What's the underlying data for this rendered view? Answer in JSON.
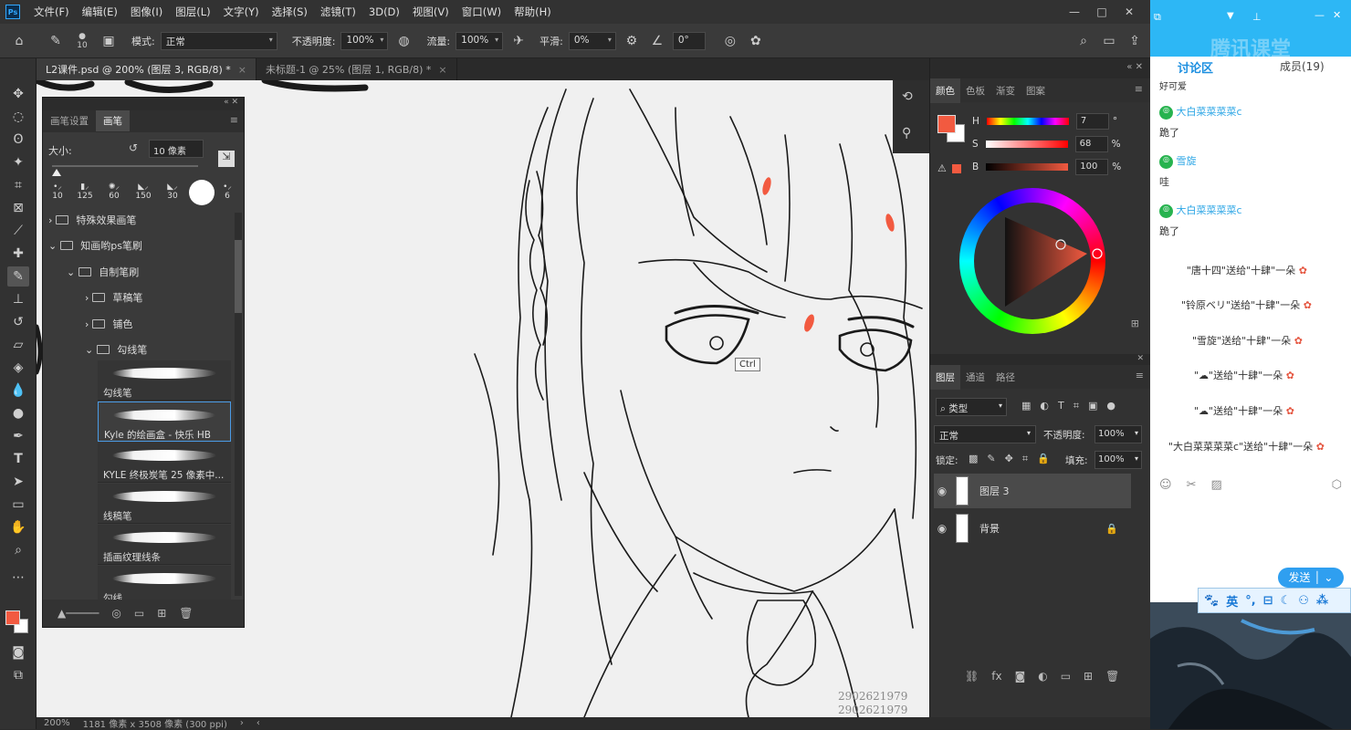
{
  "app": {
    "name": "Ps"
  },
  "menu": [
    "文件(F)",
    "编辑(E)",
    "图像(I)",
    "图层(L)",
    "文字(Y)",
    "选择(S)",
    "滤镜(T)",
    "3D(D)",
    "视图(V)",
    "窗口(W)",
    "帮助(H)"
  ],
  "window_controls": [
    "—",
    "□",
    "✕"
  ],
  "options": {
    "brush_size": "10",
    "mode_label": "模式:",
    "mode_value": "正常",
    "opacity_label": "不透明度:",
    "opacity_value": "100%",
    "flow_label": "流量:",
    "flow_value": "100%",
    "smooth_label": "平滑:",
    "smooth_value": "0%",
    "angle_value": "0°"
  },
  "tabs": [
    {
      "label": "L2课件.psd @ 200% (图层 3, RGB/8) *",
      "active": true
    },
    {
      "label": "未标题-1 @ 25% (图层 1, RGB/8) *",
      "active": false
    }
  ],
  "brush_panel": {
    "tab_settings": "画笔设置",
    "tab_brush": "画笔",
    "size_label": "大小:",
    "size_value": "10 像素",
    "presets": [
      "10",
      "125",
      "60",
      "150",
      "30",
      "6"
    ],
    "folders": [
      {
        "label": "特殊效果画笔",
        "expanded": false
      },
      {
        "label": "知画哟ps笔刷",
        "expanded": true
      },
      {
        "label": "自制笔刷",
        "expanded": true
      },
      {
        "label": "草稿笔",
        "expanded": false
      },
      {
        "label": "铺色",
        "expanded": false
      },
      {
        "label": "勾线笔",
        "expanded": true
      }
    ],
    "brushes": [
      {
        "label": "勾线笔",
        "selected": false
      },
      {
        "label": "Kyle 的绘画盒 - 快乐 HB",
        "selected": true
      },
      {
        "label": "KYLE 终极炭笔 25 像素中...",
        "selected": false
      },
      {
        "label": "线稿笔",
        "selected": false
      },
      {
        "label": "插画纹理线条",
        "selected": false
      },
      {
        "label": "勾线",
        "selected": false
      }
    ]
  },
  "color_panel": {
    "tabs": [
      "颜色",
      "色板",
      "渐变",
      "图案"
    ],
    "h_label": "H",
    "h_value": "7",
    "h_unit": "°",
    "s_label": "S",
    "s_value": "68",
    "s_unit": "%",
    "b_label": "B",
    "b_value": "100",
    "b_unit": "%",
    "foreground": "#f25a40",
    "background": "#ffffff"
  },
  "layers_panel": {
    "tabs": [
      "图层",
      "通道",
      "路径"
    ],
    "filter_label": "类型",
    "blend": "正常",
    "opacity_label": "不透明度:",
    "opacity_value": "100%",
    "lock_label": "锁定:",
    "fill_label": "填充:",
    "fill_value": "100%",
    "layers": [
      {
        "name": "图层 3",
        "selected": true,
        "locked": false
      },
      {
        "name": "背景",
        "selected": false,
        "locked": true
      }
    ]
  },
  "tooltip": "Ctrl",
  "watermark": [
    "2902621979",
    "2902621979"
  ],
  "status": {
    "zoom": "200%",
    "size": "1181 像素 x 3508 像素 (300 ppi)"
  },
  "chat": {
    "title": "腾讯课堂",
    "tab_discuss": "讨论区",
    "members": "成员(19)",
    "partial_top": "好可爱",
    "messages": [
      {
        "name": "大白菜菜菜菜c",
        "text": "跪了"
      },
      {
        "name": "雪旋",
        "text": "哇"
      },
      {
        "name": "大白菜菜菜菜c",
        "text": "跪了"
      }
    ],
    "gifts": [
      "\"唐十四\"送给\"十肆\"一朵",
      "\"铃原ベリ\"送给\"十肆\"一朵",
      "\"雪旋\"送给\"十肆\"一朵",
      "\"☁\"送给\"十肆\"一朵",
      "\"☁\"送给\"十肆\"一朵",
      "\"大白菜菜菜菜c\"送给\"十肆\"一朵"
    ],
    "send": "发送"
  },
  "ime": {
    "lang": "英"
  }
}
